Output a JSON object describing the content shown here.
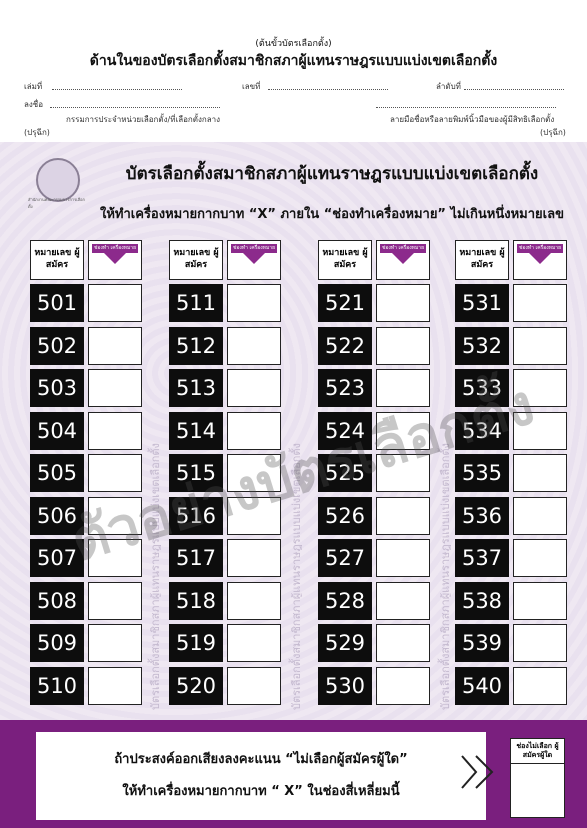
{
  "stub": {
    "label": "(ต้นขั้วบัตรเลือกตั้ง)",
    "title": "ด้านในของบัตรเลือกตั้งสมาชิกสภาผู้แทนราษฎรแบบแบ่งเขตเลือกตั้ง",
    "book_no": "เล่มที่",
    "number": "เลขที่",
    "order_no": "ลำดับที่",
    "signature": "ลงชื่อ",
    "committee": "กรรมการประจำหน่วยเลือกตั้ง/ที่เลือกตั้งกลาง",
    "voter_sign": "ลายมือชื่อหรือลายพิมพ์นิ้วมือของผู้มีสิทธิเลือกตั้ง",
    "stamp_left": "(ปรุฉีก)",
    "stamp_right": "(ปรุฉีก)"
  },
  "ballot": {
    "seal_text": "สำนักงานคณะกรรมการการเลือกตั้ง",
    "title": "บัตรเลือกตั้งสมาชิกสภาผู้แทนราษฎรแบบแบ่งเขตเลือกตั้ง",
    "instruction": "ให้ทำเครื่องหมายกากบาท “X” ภายใน “ช่องทำเครื่องหมาย” ไม่เกินหนึ่งหมายเลข",
    "header_number": "หมายเลข ผู้สมัคร",
    "header_mark": "ช่องทำ เครื่องหมาย",
    "side_text": "บัตรเลือกตั้งสมาชิกสภาผู้แทนราษฎรแบบแบ่งเขตเลือกตั้ง",
    "columns": [
      [
        "501",
        "502",
        "503",
        "504",
        "505",
        "506",
        "507",
        "508",
        "509",
        "510"
      ],
      [
        "511",
        "512",
        "513",
        "514",
        "515",
        "516",
        "517",
        "518",
        "519",
        "520"
      ],
      [
        "521",
        "522",
        "523",
        "524",
        "525",
        "526",
        "527",
        "528",
        "529",
        "530"
      ],
      [
        "531",
        "532",
        "533",
        "534",
        "535",
        "536",
        "537",
        "538",
        "539",
        "540"
      ]
    ],
    "watermark": "ตัวอย่างบัตรเลือกตั้ง"
  },
  "abstain": {
    "line1": "ถ้าประสงค์ออกเสียงลงคะแนน “ไม่เลือกผู้สมัครผู้ใด”",
    "line2": "ให้ทำเครื่องหมายกากบาท “ X” ในช่องสี่เหลี่ยมนี้",
    "box_label": "ช่องไม่เลือก ผู้สมัครผู้ใด"
  },
  "colors": {
    "accent_purple": "#7a1f7e",
    "number_bg": "#0d0d0d",
    "ballot_bg": "#ece5f1"
  }
}
